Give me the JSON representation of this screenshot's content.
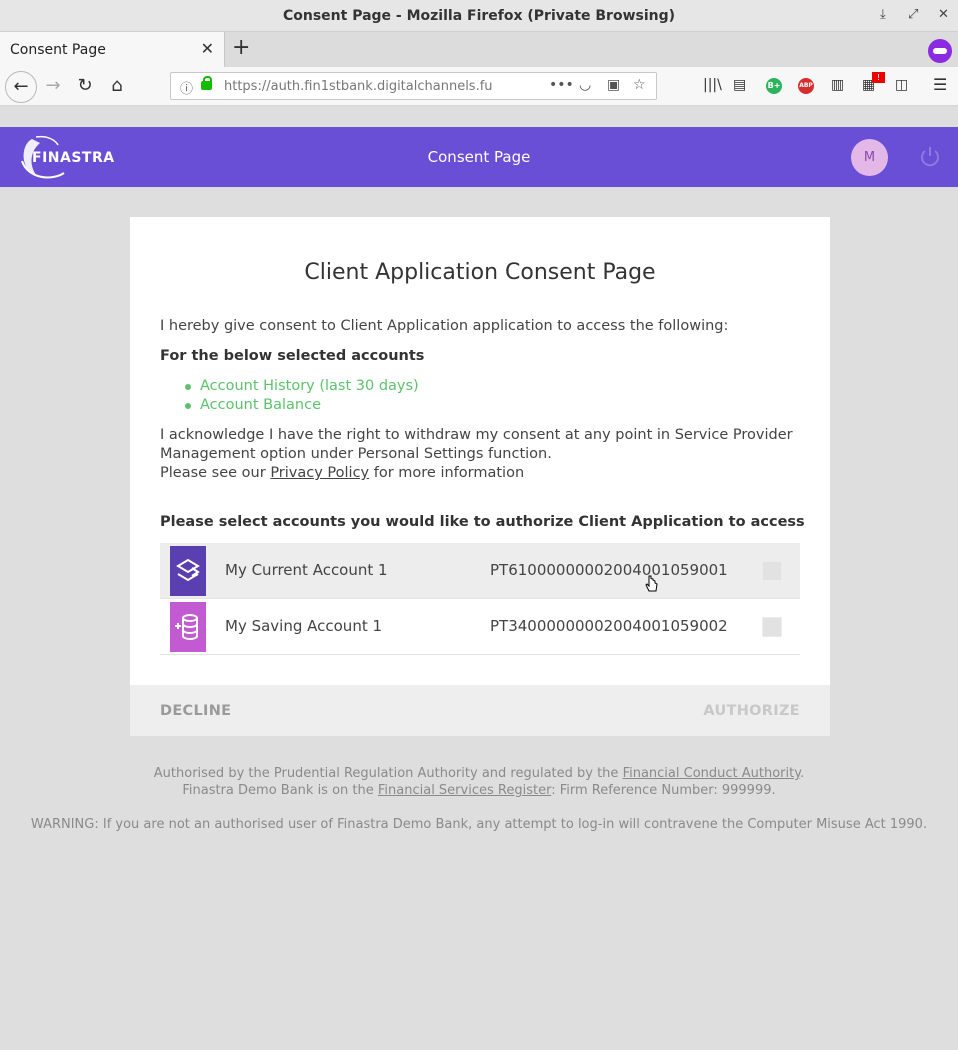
{
  "window": {
    "title": "Consent Page - Mozilla Firefox (Private Browsing)"
  },
  "tab": {
    "title": "Consent Page"
  },
  "urlbar": {
    "url": "https://auth.fin1stbank.digitalchannels.fu"
  },
  "header": {
    "logo_text": "FINASTRA",
    "title": "Consent Page",
    "avatar_initial": "M"
  },
  "consent": {
    "title": "Client Application Consent Page",
    "intro": "I hereby give consent to Client Application application to access the following:",
    "selected_heading": "For the below selected accounts",
    "permissions": [
      "Account History (last 30 days)",
      "Account Balance"
    ],
    "ack_line1": "I acknowledge I have the right to withdraw my consent at any point in Service Provider Management option under Personal Settings function.",
    "ack_prefix": "Please see our ",
    "privacy_link": "Privacy Policy",
    "ack_suffix": " for more information",
    "select_heading": "Please select accounts you would like to authorize Client Application to access",
    "accounts": [
      {
        "name": "My Current Account 1",
        "iban": "PT61000000002004001059001"
      },
      {
        "name": "My Saving Account 1",
        "iban": "PT34000000002004001059002"
      }
    ],
    "decline_label": "DECLINE",
    "authorize_label": "AUTHORIZE"
  },
  "legal": {
    "line1_prefix": "Authorised by the Prudential Regulation Authority and regulated by the ",
    "fca_link": "Financial Conduct Authority",
    "line1_suffix": ".",
    "line2_prefix": "Finastra Demo Bank is on the ",
    "fsr_link": "Financial Services Register",
    "line2_suffix": ": Firm Reference Number: 999999.",
    "warning": "WARNING: If you are not an authorised user of Finastra Demo Bank, any attempt to log-in will contravene the Computer Misuse Act 1990."
  },
  "colors": {
    "header_bg": "#694ed6",
    "permission_green": "#5cc26b",
    "current_account_icon": "#5a3fb0",
    "saving_account_icon": "#c25ad1"
  }
}
